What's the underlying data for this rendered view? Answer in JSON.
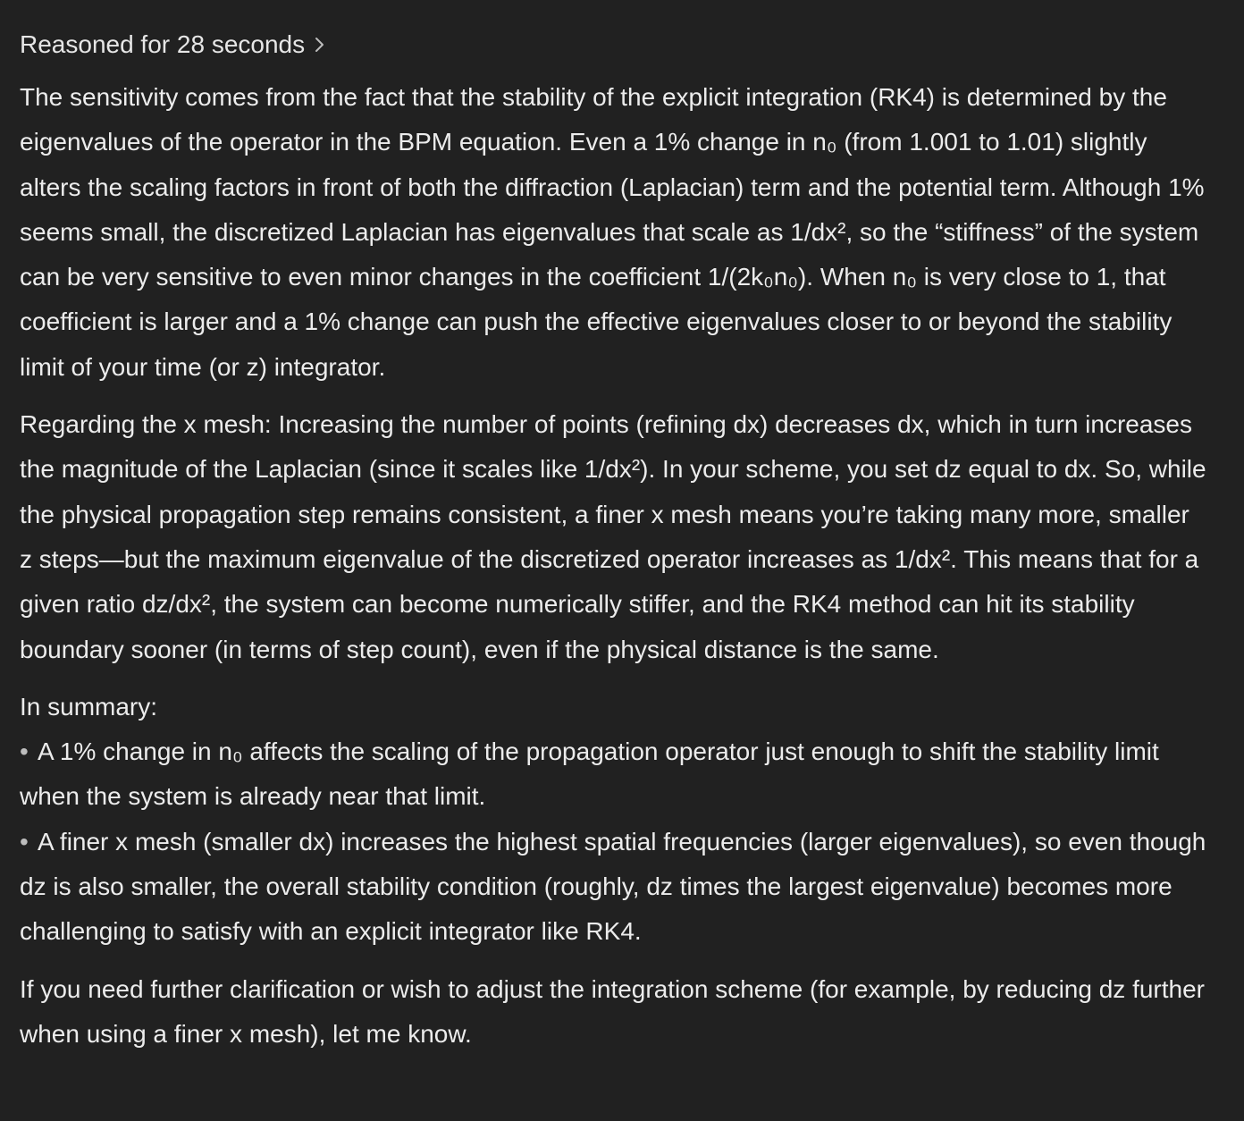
{
  "reasoning_toggle": {
    "label": "Reasoned for 28 seconds"
  },
  "message": {
    "paragraph_1": "The sensitivity comes from the fact that the stability of the explicit integration (RK4) is determined by the eigenvalues of the operator in the BPM equation. Even a 1% change in n₀ (from 1.001 to 1.01) slightly alters the scaling factors in front of both the diffraction (Laplacian) term and the potential term. Although 1% seems small, the discretized Laplacian has eigenvalues that scale as 1/dx², so the “stiffness” of the system can be very sensitive to even minor changes in the coefficient 1/(2k₀n₀). When n₀ is very close to 1, that coefficient is larger and a 1% change can push the effective eigenvalues closer to or beyond the stability limit of your time (or z) integrator.",
    "paragraph_2": "Regarding the x mesh: Increasing the number of points (refining dx) decreases dx, which in turn increases the magnitude of the Laplacian (since it scales like 1/dx²). In your scheme, you set dz equal to dx. So, while the physical propagation step remains consistent, a finer x mesh means you’re taking many more, smaller z steps—but the maximum eigenvalue of the discretized operator increases as 1/dx². This means that for a given ratio dz/dx², the system can become numerically stiffer, and the RK4 method can hit its stability boundary sooner (in terms of step count), even if the physical distance is the same.",
    "summary_heading": "In summary:",
    "bullet_symbol": "•",
    "bullets": [
      "A 1% change in n₀ affects the scaling of the propagation operator just enough to shift the stability limit when the system is already near that limit.",
      "A finer x mesh (smaller dx) increases the highest spatial frequencies (larger eigenvalues), so even though dz is also smaller, the overall stability condition (roughly, dz times the largest eigenvalue) becomes more challenging to satisfy with an explicit integrator like RK4."
    ],
    "closing": "If you need further clarification or wish to adjust the integration scheme (for example, by reducing dz further when using a finer x mesh), let me know."
  },
  "colors": {
    "background": "#212121",
    "text": "#ececec"
  },
  "icons": {
    "reasoning_toggle": "chevron-right-icon"
  }
}
